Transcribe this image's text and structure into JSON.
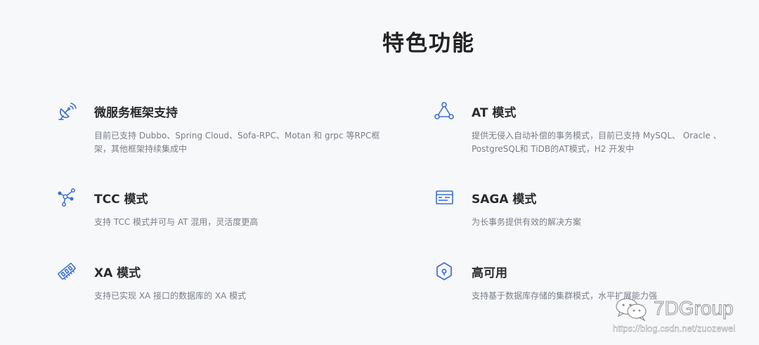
{
  "page": {
    "title": "特色功能"
  },
  "features": [
    {
      "title": "微服务框架支持",
      "description": "目前已支持 Dubbo、Spring Cloud、Sofa-RPC、Motan 和 grpc 等RPC框架，其他框架持续集成中",
      "icon": "satellite-dish-icon"
    },
    {
      "title": "AT 模式",
      "description": "提供无侵入自动补偿的事务模式，目前已支持 MySQL、 Oracle 、PostgreSQL和 TiDB的AT模式，H2 开发中",
      "icon": "triangle-nodes-icon"
    },
    {
      "title": "TCC 模式",
      "description": "支持 TCC 模式并可与 AT 混用，灵活度更高",
      "icon": "network-nodes-icon"
    },
    {
      "title": "SAGA 模式",
      "description": "为长事务提供有效的解决方案",
      "icon": "browser-window-icon"
    },
    {
      "title": "XA 模式",
      "description": "支持已实现 XA 接口的数据库的 XA 模式",
      "icon": "memory-chip-icon"
    },
    {
      "title": "高可用",
      "description": "支持基于数据库存储的集群模式，水平扩展能力强",
      "icon": "hexagon-shield-icon"
    }
  ],
  "watermark": {
    "logo_text": "7DGroup",
    "url": "https://blog.csdn.net/zuozewei",
    "icon": "wechat-icon"
  },
  "colors": {
    "background": "#f7f8fa",
    "icon_accent": "#3d6fd1",
    "title_text": "#2b2b2b",
    "description_text": "#7a7f87"
  }
}
